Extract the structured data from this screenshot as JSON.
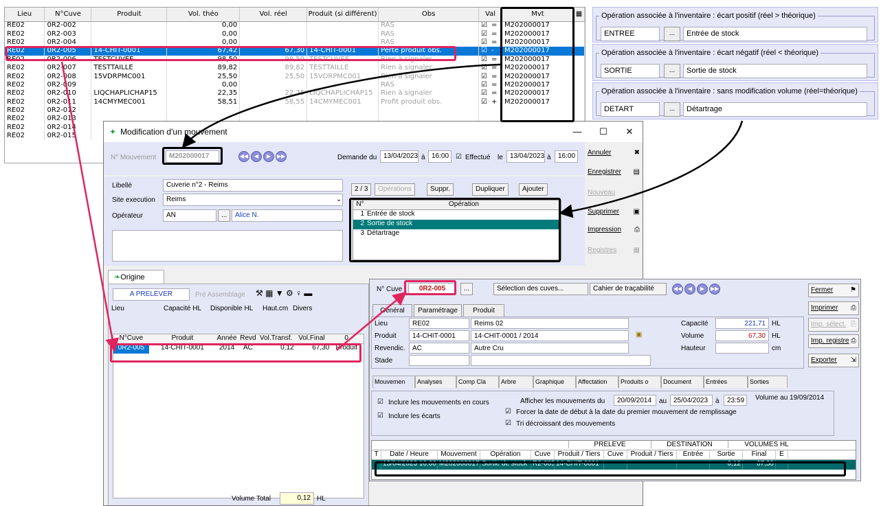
{
  "grid": {
    "headers": [
      "Lieu",
      "N°Cuve",
      "Produit",
      "Vol. théo",
      "Vol. réel",
      "Produit (si différent)",
      "Obs",
      "Val",
      "Mvt"
    ],
    "rows": [
      {
        "lieu": "RE02",
        "cuve": "0R2-002",
        "produit": "",
        "theo": "0,00",
        "reel": "",
        "pdiff": "",
        "obs": "RAS",
        "sign": "=",
        "mvt": "M202000017",
        "cls": ""
      },
      {
        "lieu": "RE02",
        "cuve": "0R2-003",
        "produit": "",
        "theo": "0,00",
        "reel": "",
        "pdiff": "",
        "obs": "RAS",
        "sign": "=",
        "mvt": "M202000017",
        "cls": ""
      },
      {
        "lieu": "RE02",
        "cuve": "0R2-004",
        "produit": "",
        "theo": "0,00",
        "reel": "",
        "pdiff": "",
        "obs": "RAS",
        "sign": "=",
        "mvt": "M202000017",
        "cls": ""
      },
      {
        "lieu": "RE02",
        "cuve": "0R2-005",
        "produit": "14-CHIT-0001",
        "theo": "67,42",
        "reel": "67,30",
        "pdiff": "14-CHIT-0001",
        "obs": "Perte produit obs.",
        "sign": "-",
        "mvt": "M202000017",
        "cls": "sel"
      },
      {
        "lieu": "RE02",
        "cuve": "0R2-006",
        "produit": "TESTCUVEE",
        "theo": "98,50",
        "reel": "98,50",
        "pdiff": "TESTCUVEE",
        "obs": "Rien à signaler",
        "sign": "=",
        "mvt": "M202000017",
        "cls": ""
      },
      {
        "lieu": "RE02",
        "cuve": "0R2-007",
        "produit": "TESTTAILLE",
        "theo": "89,82",
        "reel": "89,82",
        "pdiff": "TESTTAILLE",
        "obs": "Rien à signaler",
        "sign": "=",
        "mvt": "M202000017",
        "cls": ""
      },
      {
        "lieu": "RE02",
        "cuve": "0R2-008",
        "produit": "15VDRPMC001",
        "theo": "25,50",
        "reel": "25,50",
        "pdiff": "15VDRPMC001",
        "obs": "Rien à signaler",
        "sign": "=",
        "mvt": "M202000017",
        "cls": ""
      },
      {
        "lieu": "RE02",
        "cuve": "0R2-009",
        "produit": "",
        "theo": "0,00",
        "reel": "",
        "pdiff": "",
        "obs": "RAS",
        "sign": "=",
        "mvt": "M202000017",
        "cls": ""
      },
      {
        "lieu": "RE02",
        "cuve": "0R2-010",
        "produit": "LIQCHAPLICHAP15",
        "theo": "22,35",
        "reel": "22,35",
        "pdiff": "LIQCHAPLICHAP15",
        "obs": "Rien à signaler",
        "sign": "=",
        "mvt": "M202000017",
        "cls": ""
      },
      {
        "lieu": "RE02",
        "cuve": "0R2-011",
        "produit": "14CMYMEC001",
        "theo": "58,51",
        "reel": "58,55",
        "pdiff": "14CMYMEC001",
        "obs": "Profit produit obs.",
        "sign": "+",
        "mvt": "M202000017",
        "cls": ""
      },
      {
        "lieu": "RE02",
        "cuve": "0R2-012",
        "produit": "",
        "theo": "",
        "reel": "",
        "pdiff": "",
        "obs": "",
        "sign": "",
        "mvt": "",
        "cls": ""
      },
      {
        "lieu": "RE02",
        "cuve": "0R2-013",
        "produit": "",
        "theo": "",
        "reel": "",
        "pdiff": "",
        "obs": "",
        "sign": "",
        "mvt": "",
        "cls": ""
      },
      {
        "lieu": "RE02",
        "cuve": "0R2-014",
        "produit": "",
        "theo": "",
        "reel": "",
        "pdiff": "",
        "obs": "",
        "sign": "",
        "mvt": "",
        "cls": ""
      },
      {
        "lieu": "RE02",
        "cuve": "0R2-015",
        "produit": "",
        "theo": "",
        "reel": "",
        "pdiff": "",
        "obs": "",
        "sign": "",
        "mvt": "",
        "cls": ""
      }
    ]
  },
  "ops": [
    {
      "legend": "Opération associée à l'inventaire : écart positif (réel > théorique)",
      "code": "ENTREE",
      "label": "Entrée de stock"
    },
    {
      "legend": "Opération associée à l'inventaire : écart négatif (réel <  théorique)",
      "code": "SORTIE",
      "label": "Sortie de stock"
    },
    {
      "legend": "Opération associée à l'inventaire : sans modification volume (réel=théorique)",
      "code": "DETART",
      "label": "Détartrage"
    }
  ],
  "win": {
    "title": "Modification d'un mouvement",
    "num_label": "N° Mouvement",
    "num": "M202000017",
    "demande": "Demande du",
    "date1": "13/04/2023",
    "a1": "à",
    "time1": "16:00",
    "effectue": "Effectué",
    "le": "le",
    "date2": "13/04/2023",
    "a2": "à",
    "time2": "16:00",
    "libelle_l": "Libellé",
    "libelle": "Cuverie n°2 - Reims",
    "site_l": "Site execution",
    "site": "Reims",
    "oper_l": "Opérateur",
    "oper_code": "AN",
    "oper_name": "Alice N.",
    "counter": "2 / 3",
    "operations_btn": "Opérations",
    "suppr": "Suppr.",
    "dupliquer": "Dupliquer",
    "ajouter": "Ajouter",
    "op_col_n": "N°",
    "op_col": "Opération",
    "op_rows": [
      {
        "n": "1",
        "t": "Entrée de stock"
      },
      {
        "n": "2",
        "t": "Sortie de stock"
      },
      {
        "n": "3",
        "t": "Détartrage"
      }
    ],
    "side": [
      "Annuler",
      "Enregistrer",
      "Nouveau",
      "Supprimer",
      "Impression",
      "Registres"
    ],
    "origine_tab": "Origine",
    "aprelever": "A PRELEVER",
    "preassemblage": "Pré Assemblage",
    "orig_cols": [
      "Lieu",
      "Capacité HL",
      "Disponible HL",
      "Haut.cm",
      "Divers"
    ],
    "orig_grid_cols": [
      "N°Cuve",
      "Produit",
      "Année",
      "Revd",
      "Vol.Transf.",
      "Vol.Final",
      "0"
    ],
    "orig_row": [
      "0R2-005",
      "14-CHIT-0001",
      "2014",
      "AC",
      "0,12",
      "67,30",
      "Produit"
    ],
    "vol_total_l": "Volume Total",
    "vol_total": "0,12",
    "hl": "HL"
  },
  "cuve": {
    "ncuve_l": "N° Cuve",
    "ncuve": "0R2-005",
    "selection": "Sélection des cuves...",
    "cahier": "Cahier de traçabilité",
    "tabs": [
      "Général",
      "Paramétrage",
      "Produit"
    ],
    "lieu_l": "Lieu",
    "lieu": "RE02",
    "lieu_name": "Reims 02",
    "produit_l": "Produit",
    "produit": "14-CHIT-0001",
    "produit_name": "14-CHIT-0001 / 2014",
    "revend_l": "Revendic.",
    "revend": "AC",
    "revend_name": "Autre Cru",
    "stade_l": "Stade",
    "capacite_l": "Capacité",
    "capacite": "221,71",
    "volume_l": "Volume",
    "volume": "67,30",
    "hauteur_l": "Hauteur",
    "hl": "HL",
    "cm": "cm",
    "side": [
      "Fermer",
      "Imprimer",
      "Imp. sélect.",
      "Imp. registre",
      "Exporter"
    ],
    "subtabs": [
      "Mouvemen",
      "Analyses",
      "Comp Cla",
      "Arbre",
      "Graphique",
      "Affectation",
      "Produits o",
      "Document",
      "Entrées",
      "Sorties"
    ],
    "chk1": "Inclure les mouvements en cours",
    "chk2": "Inclure les écarts",
    "afficher": "Afficher les mouvements du",
    "from": "20/09/2014",
    "au": "au",
    "to": "25/04/2023",
    "a": "à",
    "time": "23:59",
    "chk3": "Forcer la date de début à la date du premier mouvement de remplissage",
    "chk4": "Tri décroissant des mouvements",
    "vol_au": "Volume au 19/09/2014",
    "grp": [
      "PRELEVE",
      "DESTINATION",
      "VOLUMES HL"
    ],
    "cols": [
      "T",
      "Date / Heure",
      "Mouvement",
      "Opération",
      "Cuve",
      "Produit / Tiers",
      "Cuve",
      "Produit / Tiers",
      "Entrée",
      "Sortie",
      "Final",
      "E"
    ],
    "row": [
      "",
      "13/04/2023 16:00",
      "M202000017",
      "Sortie de stock",
      "R2-005",
      "14-CHIT-0001",
      "",
      "",
      "",
      "0,12",
      "67,30",
      ""
    ]
  }
}
